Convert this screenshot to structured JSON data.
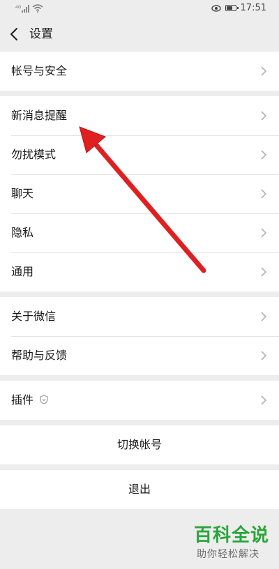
{
  "status_bar": {
    "network_label": "4G",
    "time": "17:51"
  },
  "nav": {
    "title": "设置"
  },
  "groups": [
    {
      "items": [
        {
          "label": "帐号与安全"
        }
      ]
    },
    {
      "items": [
        {
          "label": "新消息提醒"
        },
        {
          "label": "勿扰模式"
        },
        {
          "label": "聊天"
        },
        {
          "label": "隐私"
        },
        {
          "label": "通用"
        }
      ]
    },
    {
      "items": [
        {
          "label": "关于微信"
        },
        {
          "label": "帮助与反馈"
        }
      ]
    },
    {
      "items": [
        {
          "label": "插件"
        }
      ]
    }
  ],
  "actions": {
    "switch_account": "切换帐号",
    "logout": "退出"
  },
  "watermark": {
    "title": "百科全说",
    "subtitle": "助你轻松解决"
  },
  "colors": {
    "annotation_arrow": "#e02020",
    "watermark_green": "#2aa53b",
    "background": "#ededed"
  }
}
